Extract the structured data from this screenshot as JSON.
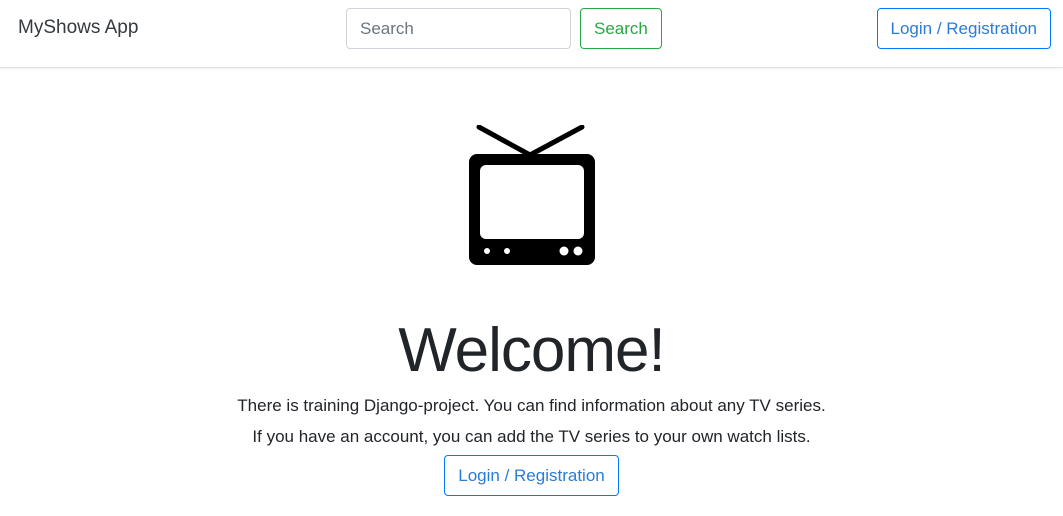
{
  "navbar": {
    "brand": "MyShows App",
    "search_placeholder": "Search",
    "search_button": "Search",
    "login_button": "Login / Registration"
  },
  "main": {
    "icon": "tv-icon",
    "heading": "Welcome!",
    "line1": "There is training Django-project. You can find information about any TV series.",
    "line2": "If you have an account, you can add the TV series to your own watch lists.",
    "login_button": "Login / Registration"
  },
  "colors": {
    "search_button": "#28a745",
    "login_button": "#007bff",
    "text": "#212529"
  }
}
